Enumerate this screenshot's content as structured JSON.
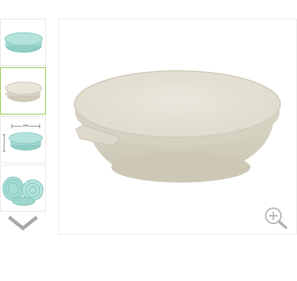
{
  "gallery": {
    "thumbnails": [
      {
        "icon": "teal-bowl-with-lid-icon",
        "selected": false
      },
      {
        "icon": "beige-bowl-with-lid-icon",
        "selected": true
      },
      {
        "icon": "bowl-dimensions-diagram-icon",
        "selected": false
      },
      {
        "icon": "stacked-bowls-set-icon",
        "selected": false
      }
    ],
    "scroll_icon": "chevron-down-icon",
    "main_image": "beige-round-food-container-with-lid",
    "zoom_icon": "zoom-in-icon"
  },
  "colors": {
    "selected_border": "#8dc63f",
    "teal": "#a8ddd6",
    "beige": "#e4e0d2"
  }
}
